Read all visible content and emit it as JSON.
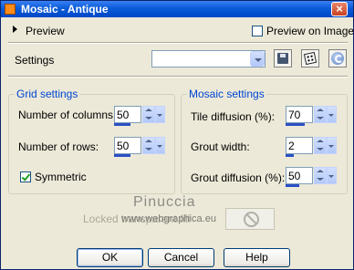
{
  "window": {
    "title": "Mosaic - Antique",
    "close_glyph": "×",
    "app_icon": "plugin-icon"
  },
  "preview": {
    "label": "Preview",
    "preview_on_image_label": "Preview on Image",
    "preview_on_image_checked": false
  },
  "settings": {
    "label": "Settings",
    "preset_value": ""
  },
  "grid_settings": {
    "title": "Grid settings",
    "columns_label": "Number of columns:",
    "columns_value": "50",
    "columns_fill": 0.6,
    "rows_label": "Number of rows:",
    "rows_value": "50",
    "rows_fill": 0.6,
    "symmetric_label": "Symmetric",
    "symmetric_checked": true
  },
  "mosaic_settings": {
    "title": "Mosaic settings",
    "tile_diffusion_label": "Tile diffusion (%):",
    "tile_diffusion_value": "70",
    "tile_diffusion_fill": 0.7,
    "grout_width_label": "Grout width:",
    "grout_width_value": "2",
    "grout_width_fill": 0.3,
    "grout_diffusion_label": "Grout diffusion (%):",
    "grout_diffusion_value": "50",
    "grout_diffusion_fill": 0.5
  },
  "locked": {
    "label": "Locked transparent fill"
  },
  "watermark": {
    "name": "Pinuccia",
    "site": "www.webgraphica.eu"
  },
  "buttons": {
    "ok": "OK",
    "cancel": "Cancel",
    "help": "Help"
  },
  "colors": {
    "title_bar": "#0a5bd8",
    "group_title": "#0046d5",
    "face": "#ece9d8"
  }
}
